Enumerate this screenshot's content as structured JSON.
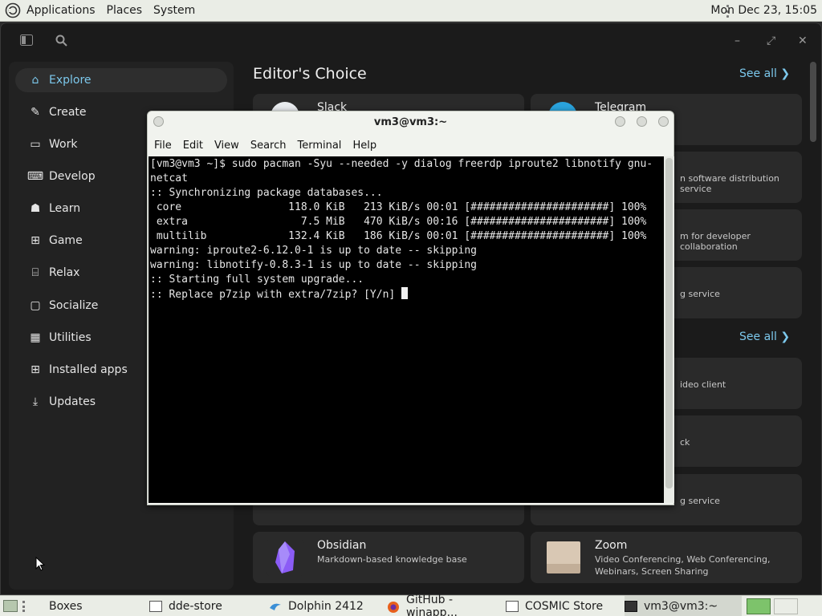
{
  "top_panel": {
    "applications": "Applications",
    "places": "Places",
    "system": "System",
    "clock": "Mon Dec 23, 15:05"
  },
  "store": {
    "nav": [
      {
        "label": "Explore",
        "icon": "home-icon"
      },
      {
        "label": "Create",
        "icon": "palette-icon"
      },
      {
        "label": "Work",
        "icon": "laptop-icon"
      },
      {
        "label": "Develop",
        "icon": "terminal-icon"
      },
      {
        "label": "Learn",
        "icon": "learn-icon"
      },
      {
        "label": "Game",
        "icon": "gamepad-icon"
      },
      {
        "label": "Relax",
        "icon": "relax-icon"
      },
      {
        "label": "Socialize",
        "icon": "chat-icon"
      },
      {
        "label": "Utilities",
        "icon": "calculator-icon"
      },
      {
        "label": "Installed apps",
        "icon": "apps-icon"
      },
      {
        "label": "Updates",
        "icon": "download-icon"
      }
    ],
    "section_title": "Editor's Choice",
    "see_all": "See all",
    "cards": {
      "slack": {
        "title": "Slack"
      },
      "telegram": {
        "title": "Telegram"
      },
      "frag1": "n software distribution service",
      "frag2": "m for developer collaboration",
      "frag3": "g service",
      "frag4": "ideo client",
      "frag5": "ck",
      "frag6": "g service",
      "obsidian": {
        "title": "Obsidian",
        "subtitle": "Markdown-based knowledge base"
      },
      "zoom": {
        "title": "Zoom",
        "subtitle": "Video Conferencing, Web Conferencing, Webinars, Screen Sharing"
      }
    }
  },
  "terminal": {
    "title": "vm3@vm3:~",
    "menu": [
      "File",
      "Edit",
      "View",
      "Search",
      "Terminal",
      "Help"
    ],
    "lines": [
      "[vm3@vm3 ~]$ sudo pacman -Syu --needed -y dialog freerdp iproute2 libnotify gnu-",
      "netcat",
      ":: Synchronizing package databases...",
      " core                 118.0 KiB   213 KiB/s 00:01 [######################] 100%",
      " extra                  7.5 MiB   470 KiB/s 00:16 [######################] 100%",
      " multilib             132.4 KiB   186 KiB/s 00:01 [######################] 100%",
      "warning: iproute2-6.12.0-1 is up to date -- skipping",
      "warning: libnotify-0.8.3-1 is up to date -- skipping",
      ":: Starting full system upgrade...",
      ":: Replace p7zip with extra/7zip? [Y/n] "
    ]
  },
  "taskbar": {
    "items": [
      {
        "label": "Boxes"
      },
      {
        "label": "dde-store"
      },
      {
        "label": "Dolphin 2412"
      },
      {
        "label": "GitHub - winapp..."
      },
      {
        "label": "COSMIC Store"
      },
      {
        "label": "vm3@vm3:~"
      }
    ]
  }
}
